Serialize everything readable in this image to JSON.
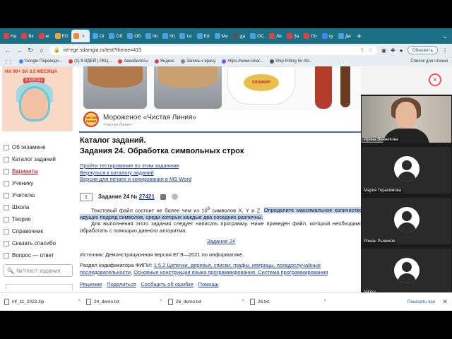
{
  "tabs": [
    {
      "label": "На",
      "color": "#e04040"
    },
    {
      "label": "Вк",
      "color": "#e04040"
    },
    {
      "label": "ег",
      "color": "#e04040"
    },
    {
      "label": "ЕG",
      "color": "#e8a53a"
    },
    {
      "label": "",
      "color": "#f08a30",
      "active": true
    },
    {
      "label": "Ol",
      "color": "#4aa3df"
    },
    {
      "label": "Об",
      "color": "#4aa3df"
    },
    {
      "label": "Об",
      "color": "#4aa3df"
    },
    {
      "label": "htt",
      "color": "#4aa3df"
    },
    {
      "label": "htt",
      "color": "#4aa3df"
    },
    {
      "label": "Le",
      "color": "#4aa3df"
    },
    {
      "label": "Ed",
      "color": "#4aa3df"
    },
    {
      "label": "Ме",
      "color": "#4aa3df"
    },
    {
      "label": "да",
      "color": "#555555"
    },
    {
      "label": "ОС",
      "color": "#4aa3df"
    },
    {
      "label": "Ли",
      "color": "#e04040"
    },
    {
      "label": "За",
      "color": "#e04040"
    },
    {
      "label": "По",
      "color": "#e04040"
    },
    {
      "label": "ку",
      "color": "#4285f4"
    },
    {
      "label": "Де",
      "color": "#4aa3df"
    }
  ],
  "tab_new": "+",
  "window_control": "⌄",
  "address": {
    "url": "inf-ege.sdamgia.ru/test?theme=413",
    "update_label": "Обновить"
  },
  "bookmarks": [
    {
      "label": "Google Переводч...",
      "color": "#4285f4"
    },
    {
      "label": "(1) 8 ИДЕЙ | РЕЦ...",
      "color": "#e04040"
    },
    {
      "label": "Авиабилеты",
      "color": "#e04040"
    },
    {
      "label": "Яндекс",
      "color": "#e04040"
    },
    {
      "label": "Запись к врачу",
      "color": "#888888"
    },
    {
      "label": "https://www.smar...",
      "color": "#8a4fd8"
    },
    {
      "label": "Ship Fitting for Ab...",
      "color": "#555555"
    }
  ],
  "bookmarks_right": "Список для чтения",
  "promo": {
    "text": "НА 90+ ЗА 3,5 МЕСЯЦА",
    "badge": "В КУРСАХ"
  },
  "sidenav": [
    {
      "label": "Об экзамене",
      "red": false
    },
    {
      "label": "Каталог заданий",
      "red": false
    },
    {
      "label": "Варианты",
      "red": true
    },
    {
      "label": "Ученику",
      "red": false
    },
    {
      "label": "Учителю",
      "red": false
    },
    {
      "label": "Школа",
      "red": false
    },
    {
      "label": "Теория",
      "red": false
    },
    {
      "label": "Справочник",
      "red": false
    },
    {
      "label": "Сказать спасибо",
      "red": false
    },
    {
      "label": "Вопрос — ответ",
      "red": false
    }
  ],
  "side_search_placeholder": "№/текст задания",
  "ad": {
    "title": "Мороженое «Чистая Линия»",
    "subtitle": "«Чистая Линия»",
    "logo_text": "ЧИСТАЯ ЛИНИЯ",
    "pack_brand": "ПЛОМБИР"
  },
  "catalog": {
    "title_line1": "Каталог заданий.",
    "title_line2": "Задания 24. Обработка символьных строк",
    "links": [
      "Пройти тестирование по этим заданиям",
      "Вернуться к каталогу заданий",
      "Версия для печати и копирования в MS Word"
    ],
    "task_number": "1",
    "task_label": "Задание 24 №",
    "task_id": "27421",
    "para1_a": "Текстовый файл состоит не более чем из 10",
    "para1_sup": "6",
    "para1_b": " символов X, Y и Z. ",
    "para1_hl": "Определите максимальное количество идущих подряд символов, среди которых каждые два соседних различны.",
    "para2": "Для выполнения этого задания следует написать программу. Ниже приведён файл, который необходимо обработать с помощью данного алгоритма.",
    "center_link": "Задание 24",
    "source": "Источник: Демонстрационная версия ЕГЭ—2021 по информатике.",
    "codifier_label": "Раздел кодификатора ФИПИ: ",
    "codifier_link1": "1.5.2 Цепочки, деревья, списки, графы, матрицы, псевдослучайные последовательности",
    "codifier_sep": ", ",
    "codifier_link2": "Основные конструкции языка программирования. Система программирования",
    "actions": [
      "Решение",
      "Поделиться",
      "Сообщить об ошибке",
      "Помощь"
    ],
    "action_sep": " · "
  },
  "call": {
    "close_icon": "✕",
    "participants": [
      {
        "name": "Ирина Винникова",
        "video": true
      },
      {
        "name": "Мария Герасимова",
        "video": false
      },
      {
        "name": "Роман Рыжиков",
        "video": false
      },
      {
        "name": "Nikitos",
        "video": false
      }
    ]
  },
  "downloads": {
    "files": [
      "inf_11_2022.zip",
      "24_demo.txt",
      "26_demo.txt",
      "26.txt"
    ],
    "show_all": "Показать все",
    "chevron": "^",
    "close": "✕"
  }
}
